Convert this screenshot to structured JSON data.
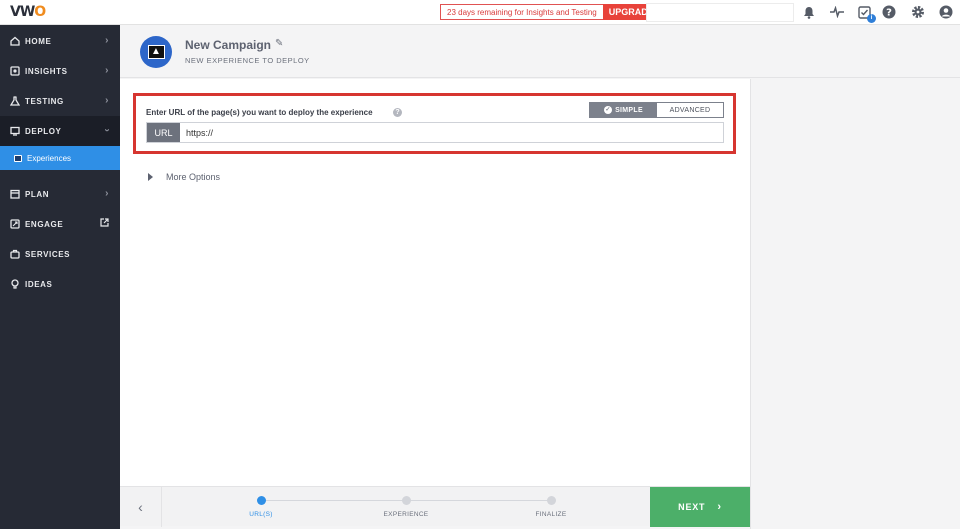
{
  "app": {
    "logo_main": "VW",
    "logo_accent": "O"
  },
  "topbar": {
    "trial_text": "23 days remaining for Insights and Testing",
    "upgrade_label": "UPGRADE",
    "icons": [
      "bell-icon",
      "pulse-icon",
      "checklist-icon",
      "help-icon",
      "gear-icon",
      "user-icon"
    ],
    "checklist_badge": "i"
  },
  "sidebar": {
    "items": [
      {
        "label": "HOME",
        "icon": "home-icon"
      },
      {
        "label": "INSIGHTS",
        "icon": "insights-icon"
      },
      {
        "label": "TESTING",
        "icon": "flask-icon"
      },
      {
        "label": "DEPLOY",
        "icon": "deploy-icon"
      },
      {
        "label": "PLAN",
        "icon": "plan-icon"
      },
      {
        "label": "ENGAGE",
        "icon": "engage-icon"
      },
      {
        "label": "SERVICES",
        "icon": "briefcase-icon"
      },
      {
        "label": "IDEAS",
        "icon": "lightbulb-icon"
      }
    ],
    "subitem": {
      "label": "Experiences"
    }
  },
  "header": {
    "title": "New Campaign",
    "subtitle": "NEW EXPERIENCE TO DEPLOY"
  },
  "form": {
    "url_label": "Enter URL of the page(s) you want to deploy the experience",
    "mode_simple": "SIMPLE",
    "mode_advanced": "ADVANCED",
    "mode_selected": "SIMPLE",
    "url_tag": "URL",
    "url_value": "https://",
    "more_options": "More Options"
  },
  "stepper": {
    "steps": [
      {
        "label": "URL(S)",
        "active": true
      },
      {
        "label": "EXPERIENCE",
        "active": false
      },
      {
        "label": "FINALIZE",
        "active": false
      }
    ],
    "next_label": "NEXT"
  },
  "colors": {
    "sidebar_bg": "#262a35",
    "accent_blue": "#2f8fe6",
    "highlight_red": "#d63530",
    "next_green": "#4caf69"
  }
}
